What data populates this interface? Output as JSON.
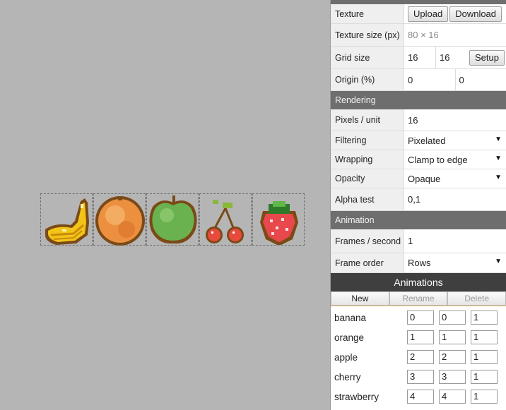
{
  "colors": {
    "section": "#6e6e6e",
    "anim_header": "#3f3f3f",
    "canvas_bg": "#b5b5b5"
  },
  "canvas": {
    "sprites": [
      {
        "name": "banana"
      },
      {
        "name": "orange"
      },
      {
        "name": "apple"
      },
      {
        "name": "cherry"
      },
      {
        "name": "strawberry"
      }
    ]
  },
  "texture": {
    "label": "Texture",
    "upload": "Upload",
    "download": "Download",
    "size_label": "Texture size (px)",
    "size_value": "80 × 16",
    "grid_label": "Grid size",
    "grid_w": "16",
    "grid_h": "16",
    "setup": "Setup",
    "origin_label": "Origin (%)",
    "origin_x": "0",
    "origin_y": "0"
  },
  "rendering": {
    "header": "Rendering",
    "ppu_label": "Pixels / unit",
    "ppu_value": "16",
    "filtering_label": "Filtering",
    "filtering_value": "Pixelated",
    "wrapping_label": "Wrapping",
    "wrapping_value": "Clamp to edge",
    "opacity_label": "Opacity",
    "opacity_value": "Opaque",
    "alpha_label": "Alpha test",
    "alpha_value": "0,1"
  },
  "animation": {
    "header": "Animation",
    "fps_label": "Frames / second",
    "fps_value": "1",
    "order_label": "Frame order",
    "order_value": "Rows"
  },
  "animations": {
    "title": "Animations",
    "new": "New",
    "rename": "Rename",
    "delete": "Delete",
    "rows": [
      {
        "name": "banana",
        "start": "0",
        "end": "0",
        "speed": "1"
      },
      {
        "name": "orange",
        "start": "1",
        "end": "1",
        "speed": "1"
      },
      {
        "name": "apple",
        "start": "2",
        "end": "2",
        "speed": "1"
      },
      {
        "name": "cherry",
        "start": "3",
        "end": "3",
        "speed": "1"
      },
      {
        "name": "strawberry",
        "start": "4",
        "end": "4",
        "speed": "1"
      }
    ]
  }
}
